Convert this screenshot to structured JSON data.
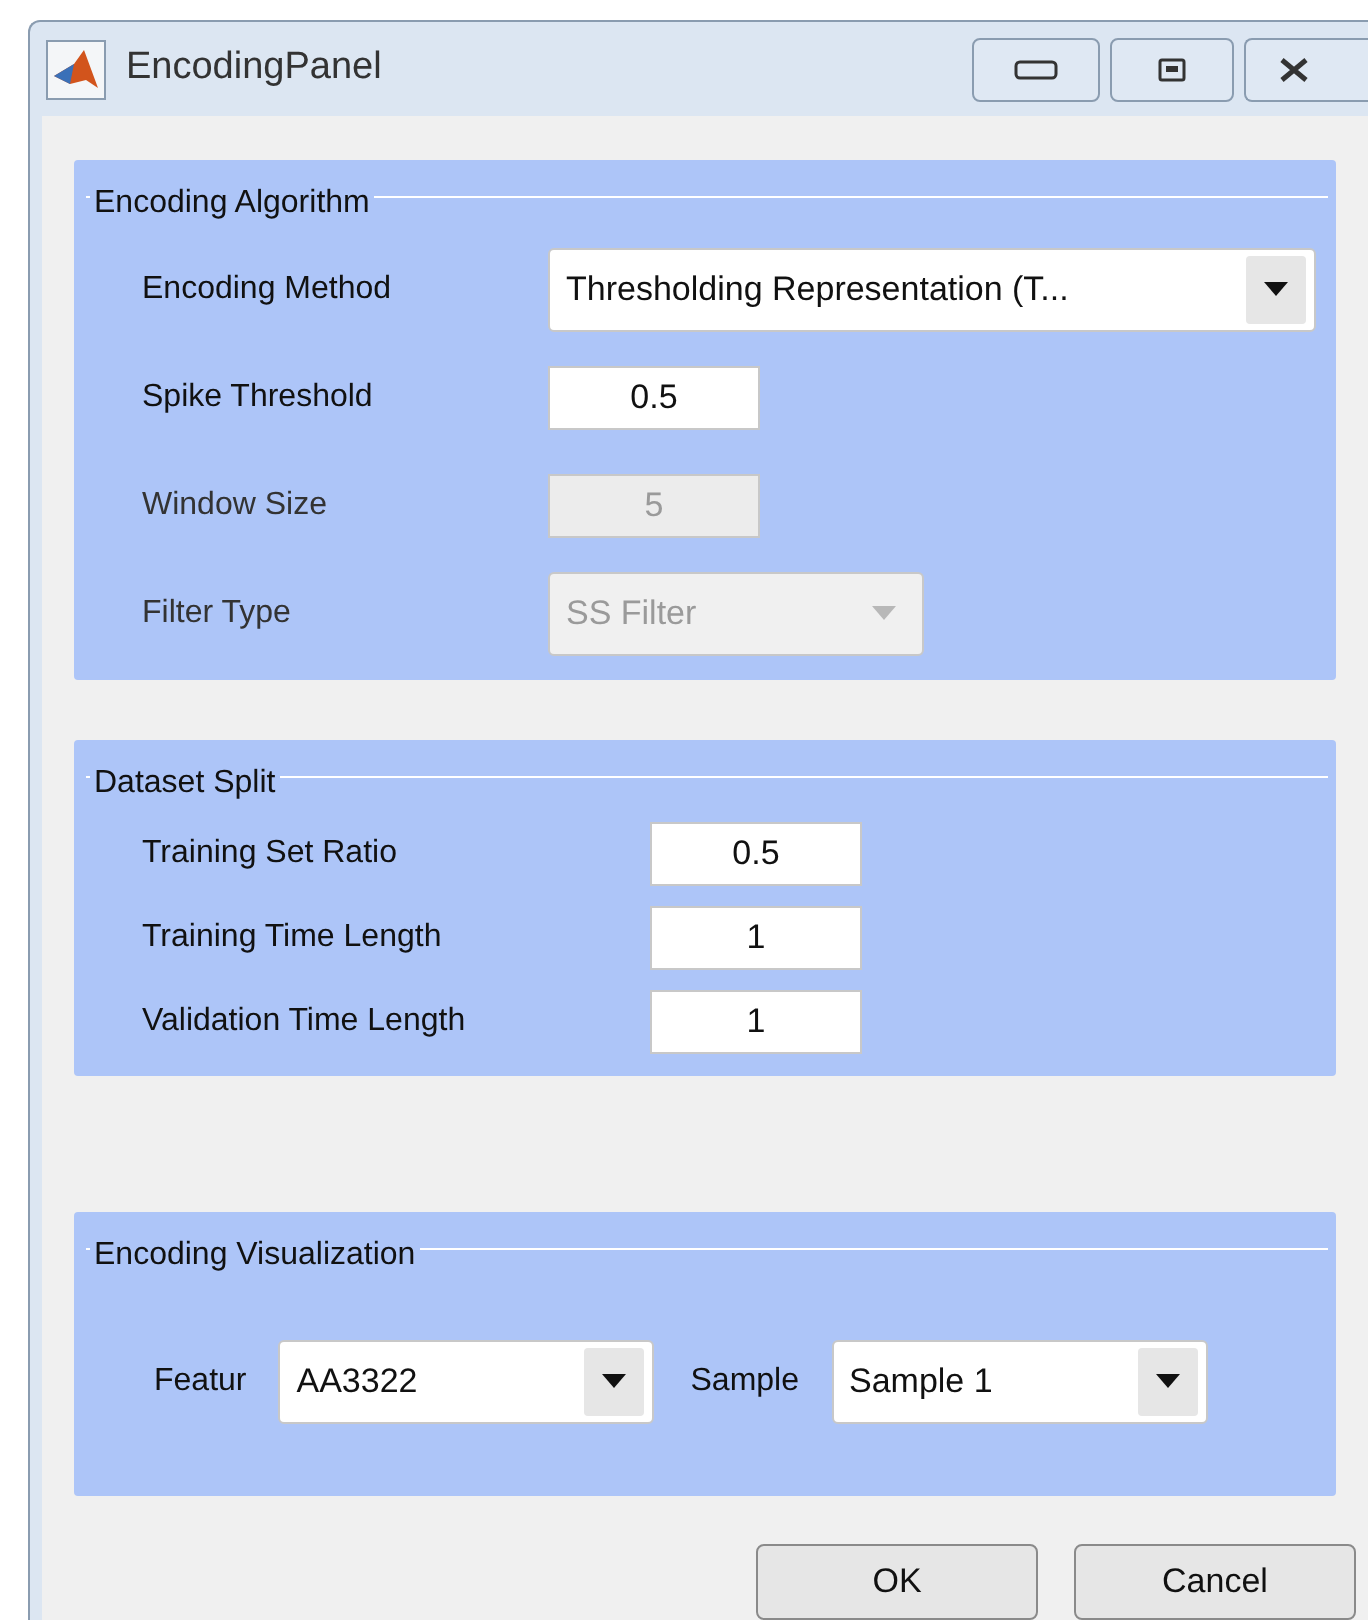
{
  "window": {
    "title": "EncodingPanel"
  },
  "panels": [
    {
      "title": "Encoding Algorithm",
      "kind": "stacked",
      "rows": [
        {
          "label": "Encoding Method",
          "kind": "dropdown",
          "value": "Thresholding Representation (T...",
          "disabled": false
        },
        {
          "label": "Spike Threshold",
          "kind": "field",
          "value": "0.5",
          "disabled": false
        },
        {
          "label": "Window Size",
          "kind": "field",
          "value": "5",
          "disabled": true
        },
        {
          "label": "Filter Type",
          "kind": "dropdown",
          "value": "SS Filter",
          "disabled": true
        }
      ]
    },
    {
      "title": "Dataset Split",
      "kind": "stacked",
      "rows": [
        {
          "label": "Training Set Ratio",
          "kind": "field",
          "value": "0.5",
          "disabled": false
        },
        {
          "label": "Training Time Length",
          "kind": "field",
          "value": "1",
          "disabled": false
        },
        {
          "label": "Validation Time Length",
          "kind": "field",
          "value": "1",
          "disabled": false
        }
      ]
    },
    {
      "title": "Encoding Visualization",
      "kind": "inline",
      "rows": [
        {
          "label": "Featur",
          "kind": "dropdown",
          "value": "AA3322",
          "disabled": false
        },
        {
          "label": "Sample",
          "kind": "dropdown",
          "value": "Sample 1",
          "disabled": false
        }
      ]
    }
  ],
  "buttons": [
    "OK",
    "Cancel"
  ]
}
